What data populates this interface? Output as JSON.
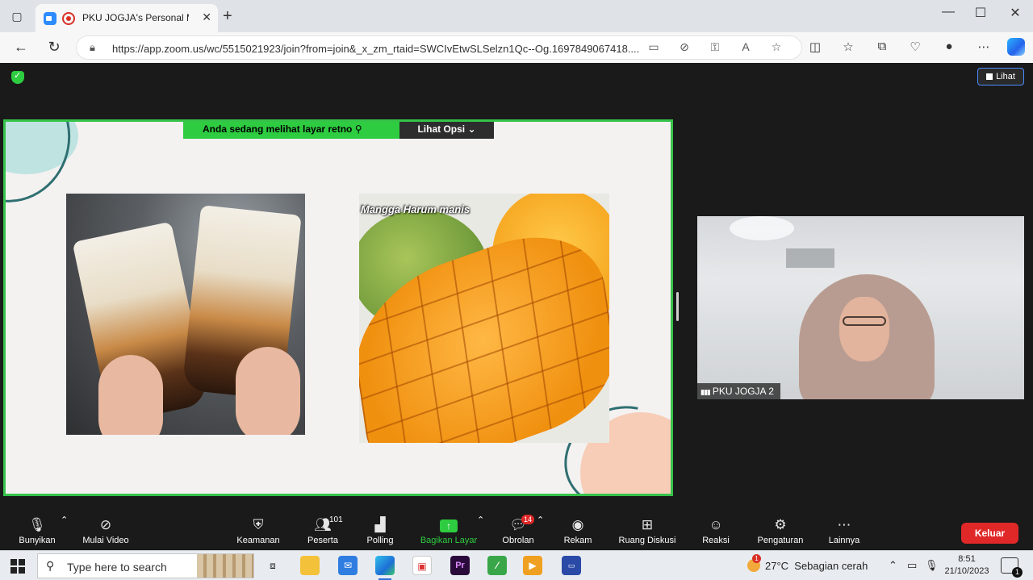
{
  "browser": {
    "tab_title": "PKU JOGJA's Personal Meeti",
    "url": "https://app.zoom.us/wc/5515021923/join?from=join&_x_zm_rtaid=SWCIvEtwSLSelzn1Qc--Og.1697849067418...."
  },
  "meeting": {
    "view_button": "Lihat",
    "share_banner": "Anda sedang melihat layar  retno",
    "view_options": "Lihat Opsi",
    "slide": {
      "image2_caption": "Mangga Harum manis"
    },
    "participant": {
      "name": "PKU JOGJA 2"
    }
  },
  "toolbar": {
    "unmute": "Bunyikan",
    "start_video": "Mulai Video",
    "security": "Keamanan",
    "participants": "Peserta",
    "participants_count": "101",
    "polling": "Polling",
    "share_screen": "Bagikan Layar",
    "chat": "Obrolan",
    "chat_badge": "14",
    "record": "Rekam",
    "breakout": "Ruang Diskusi",
    "reactions": "Reaksi",
    "settings": "Pengaturan",
    "more": "Lainnya",
    "leave": "Keluar"
  },
  "taskbar": {
    "search_placeholder": "Type here to search",
    "weather_temp": "27°C",
    "weather_desc": "Sebagian cerah",
    "weather_badge": "1",
    "time": "8:51",
    "date": "21/10/2023",
    "notification_count": "1"
  },
  "colors": {
    "zoom_green": "#2ecc40",
    "leave_red": "#e02828",
    "zoom_blue": "#2d8cff"
  }
}
